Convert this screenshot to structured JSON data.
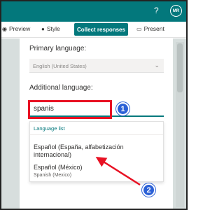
{
  "topbar": {
    "help": "?",
    "avatar": "MR"
  },
  "toolbar": {
    "preview": "Preview",
    "style": "Style",
    "collect": "Collect responses",
    "present": "Present"
  },
  "panel": {
    "primary_label": "Primary language:",
    "primary_value": "English (United States)",
    "additional_label": "Additional language:",
    "search_value": "spanis",
    "list_header": "Language list",
    "options": [
      {
        "label": "Español (España, alfabetización internacional)"
      },
      {
        "label": "Español (México)",
        "sub": "Spanish (Mexico)"
      }
    ]
  },
  "annotations": {
    "step1": "1",
    "step2": "2"
  },
  "colors": {
    "accent": "#03787c",
    "highlight": "#e81123",
    "badge": "#2b60d6"
  },
  "icons": [
    "help-icon",
    "preview-icon",
    "palette-icon",
    "present-icon",
    "chevron-down-icon"
  ]
}
